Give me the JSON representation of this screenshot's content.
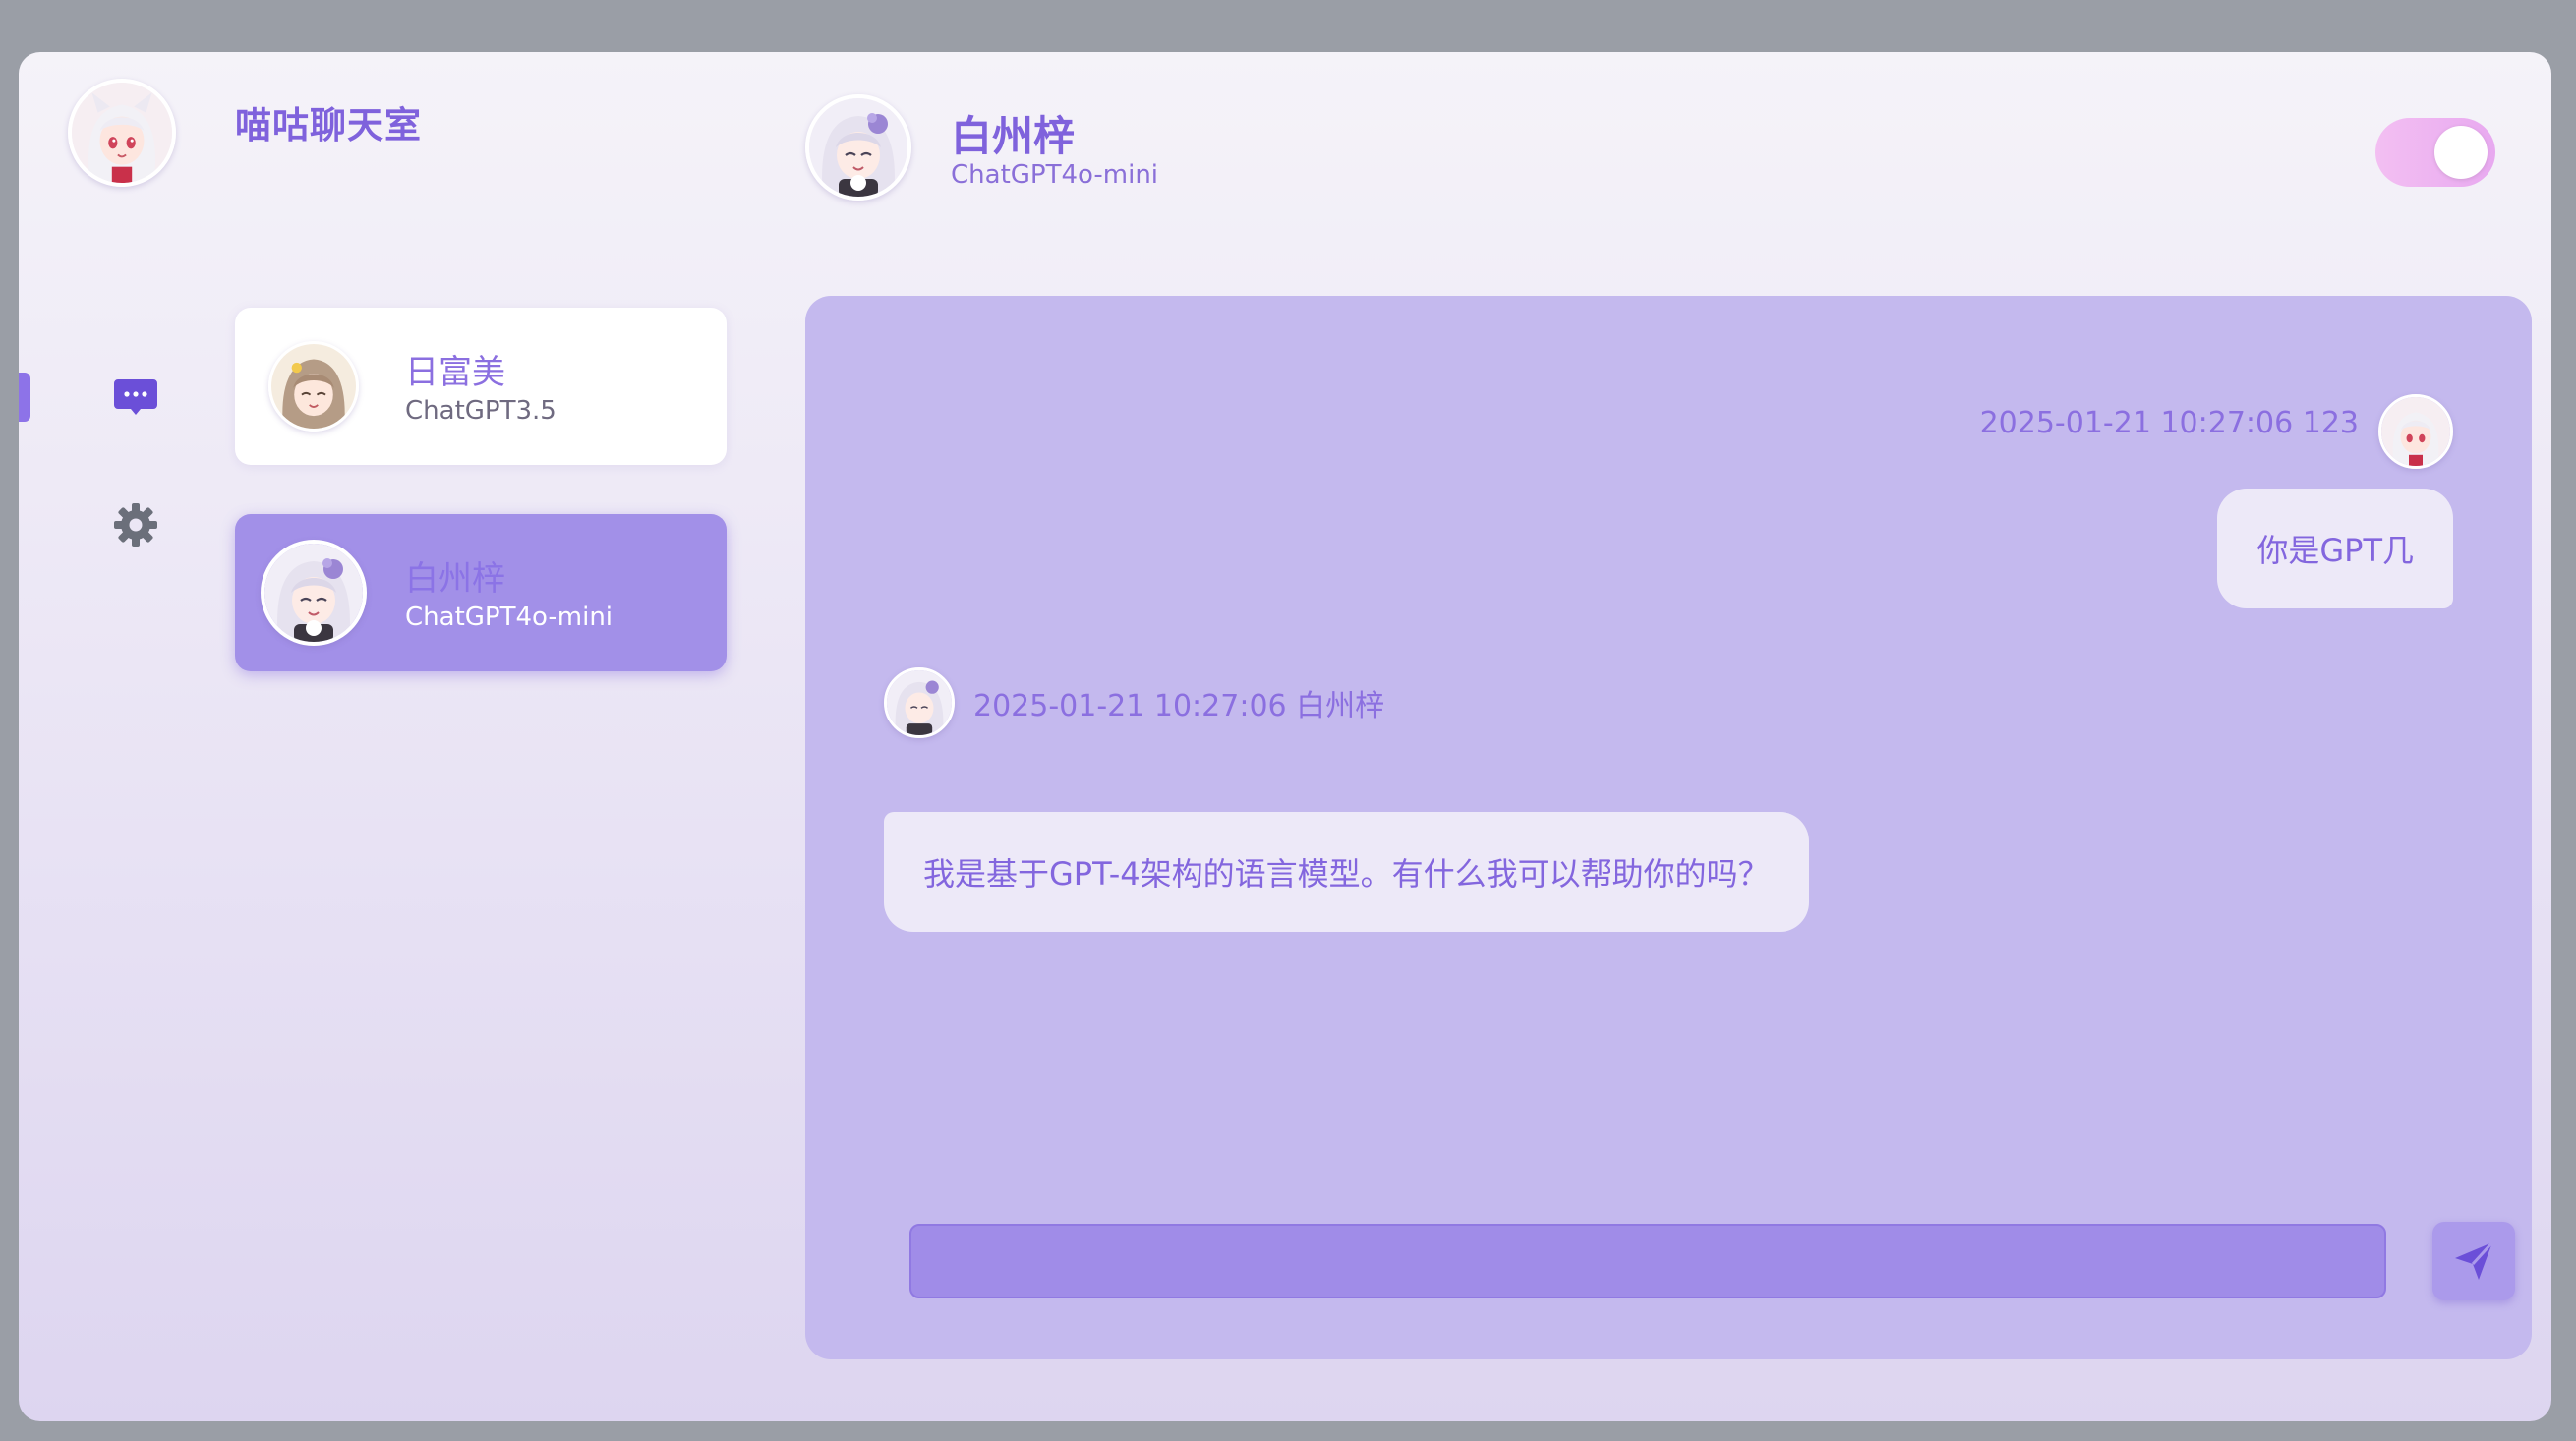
{
  "app": {
    "title": "喵咕聊天室",
    "user_avatar": "white-hair-red-eyes-anime-girl"
  },
  "nav": {
    "items": [
      {
        "name": "chat",
        "icon": "chat-bubble-icon",
        "active": true
      },
      {
        "name": "settings",
        "icon": "gear-icon",
        "active": false
      }
    ]
  },
  "contacts": [
    {
      "name": "日富美",
      "model": "ChatGPT3.5",
      "avatar": "brown-hair-anime-girl",
      "active": false
    },
    {
      "name": "白州梓",
      "model": "ChatGPT4o-mini",
      "avatar": "white-purple-hair-anime-girl",
      "active": true
    }
  ],
  "header": {
    "name": "白州梓",
    "model": "ChatGPT4o-mini",
    "toggle_on": true
  },
  "messages": [
    {
      "from": "me",
      "meta": "2025-01-21 10:27:06 123",
      "text": "你是GPT几"
    },
    {
      "from": "bot",
      "meta": "2025-01-21 10:27:06  白州梓",
      "text": "我是基于GPT-4架构的语言模型。有什么我可以帮助你的吗？"
    }
  ],
  "input": {
    "value": "",
    "placeholder": ""
  },
  "colors": {
    "accent": "#7f62dc",
    "panel": "#c4b9ee",
    "active_card": "#a290e8",
    "bubble": "#ede9f8",
    "toggle": "#f3bff2"
  }
}
